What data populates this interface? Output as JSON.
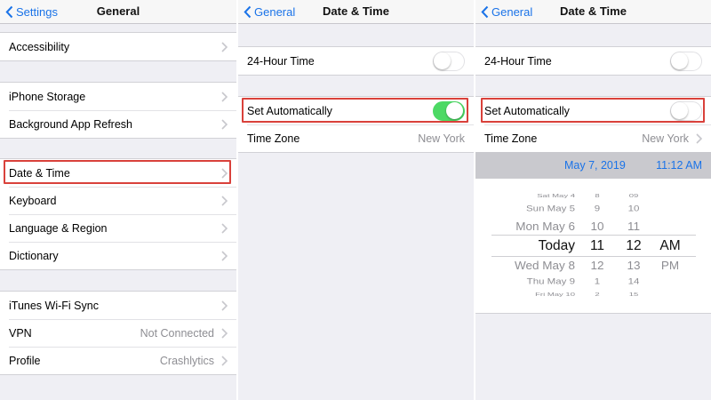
{
  "panel1": {
    "back_label": "Settings",
    "title": "General",
    "groups": [
      [
        {
          "label": "Accessibility"
        }
      ],
      [
        {
          "label": "iPhone Storage"
        },
        {
          "label": "Background App Refresh"
        }
      ],
      [
        {
          "label": "Date & Time"
        },
        {
          "label": "Keyboard"
        },
        {
          "label": "Language & Region"
        },
        {
          "label": "Dictionary"
        }
      ],
      [
        {
          "label": "iTunes Wi-Fi Sync",
          "value": ""
        },
        {
          "label": "VPN",
          "value": "Not Connected"
        },
        {
          "label": "Profile",
          "value": "Crashlytics"
        }
      ]
    ]
  },
  "panel2": {
    "back_label": "General",
    "title": "Date & Time",
    "rows": {
      "hour24": {
        "label": "24-Hour Time",
        "on": false
      },
      "set_auto": {
        "label": "Set Automatically",
        "on": true
      },
      "time_zone": {
        "label": "Time Zone",
        "value": "New York"
      }
    }
  },
  "panel3": {
    "back_label": "General",
    "title": "Date & Time",
    "rows": {
      "hour24": {
        "label": "24-Hour Time",
        "on": false
      },
      "set_auto": {
        "label": "Set Automatically",
        "on": false
      },
      "time_zone": {
        "label": "Time Zone",
        "value": "New York"
      }
    },
    "current_date": "May 7, 2019",
    "current_time": "11:12 AM",
    "picker": {
      "days": [
        "Sat May 4",
        "Sun May 5",
        "Mon May 6",
        "Today",
        "Wed May 8",
        "Thu May 9",
        "Fri May 10"
      ],
      "hours": [
        "8",
        "9",
        "10",
        "11",
        "12",
        "1",
        "2"
      ],
      "minutes": [
        "09",
        "10",
        "11",
        "12",
        "13",
        "14",
        "15"
      ],
      "ampm": [
        "AM",
        "PM"
      ],
      "selected_index": 3
    }
  },
  "colors": {
    "accent": "#1a73e8",
    "toggle_on": "#4cd964",
    "highlight": "#d9413b",
    "secondary_text": "#8e8e93"
  }
}
